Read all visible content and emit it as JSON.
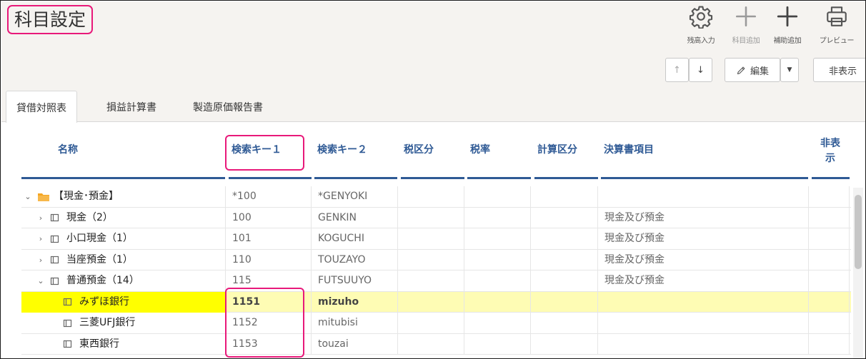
{
  "title": "科目設定",
  "toolbar": {
    "balance_input": "残高入力",
    "add_account": "科目追加",
    "add_sub": "補助追加",
    "preview": "プレビュー",
    "up": "↑",
    "down": "↓",
    "edit": "編集",
    "hide": "非表示"
  },
  "tabs": [
    {
      "label": "貸借対照表"
    },
    {
      "label": "損益計算書"
    },
    {
      "label": "製造原価報告書"
    }
  ],
  "columns": {
    "name": "名称",
    "key1": "検索キー１",
    "key2": "検索キー２",
    "tax_class": "税区分",
    "tax_rate": "税率",
    "calc_class": "計算区分",
    "statement_item": "決算書項目",
    "hidden": "非表示"
  },
  "rows": [
    {
      "name": "【現金･預金】",
      "key1": "*100",
      "key2": "*GENYOKI",
      "tax_class": "",
      "tax_rate": "",
      "calc_class": "",
      "statement_item": "",
      "hidden": "",
      "twisty": "⌄",
      "icon": "folder-icon"
    },
    {
      "name": "現金（2）",
      "key1": "100",
      "key2": "GENKIN",
      "tax_class": "",
      "tax_rate": "",
      "calc_class": "",
      "statement_item": "現金及び預金",
      "hidden": "",
      "twisty": "›",
      "icon": "account-icon"
    },
    {
      "name": "小口現金（1）",
      "key1": "101",
      "key2": "KOGUCHI",
      "tax_class": "",
      "tax_rate": "",
      "calc_class": "",
      "statement_item": "現金及び預金",
      "hidden": "",
      "twisty": "›",
      "icon": "account-icon"
    },
    {
      "name": "当座預金（1）",
      "key1": "110",
      "key2": "TOUZAYO",
      "tax_class": "",
      "tax_rate": "",
      "calc_class": "",
      "statement_item": "現金及び預金",
      "hidden": "",
      "twisty": "›",
      "icon": "account-icon"
    },
    {
      "name": "普通預金（14）",
      "key1": "115",
      "key2": "FUTSUUYO",
      "tax_class": "",
      "tax_rate": "",
      "calc_class": "",
      "statement_item": "現金及び預金",
      "hidden": "",
      "twisty": "⌄",
      "icon": "account-icon"
    },
    {
      "name": "みずほ銀行",
      "key1": "1151",
      "key2": "mizuho",
      "tax_class": "",
      "tax_rate": "",
      "calc_class": "",
      "statement_item": "",
      "hidden": "",
      "twisty": "",
      "icon": "account-icon",
      "selected": true
    },
    {
      "name": "三菱UFJ銀行",
      "key1": "1152",
      "key2": "mitubisi",
      "tax_class": "",
      "tax_rate": "",
      "calc_class": "",
      "statement_item": "",
      "hidden": "",
      "twisty": "",
      "icon": "account-icon"
    },
    {
      "name": "東西銀行",
      "key1": "1153",
      "key2": "touzai",
      "tax_class": "",
      "tax_rate": "",
      "calc_class": "",
      "statement_item": "",
      "hidden": "",
      "twisty": "",
      "icon": "account-icon"
    }
  ],
  "colors": {
    "accent": "#2f5a95",
    "highlight_box": "#e8197a",
    "selected_row": "#fefcb4",
    "selected_name": "#ffff00",
    "folder": "#f5a623"
  }
}
